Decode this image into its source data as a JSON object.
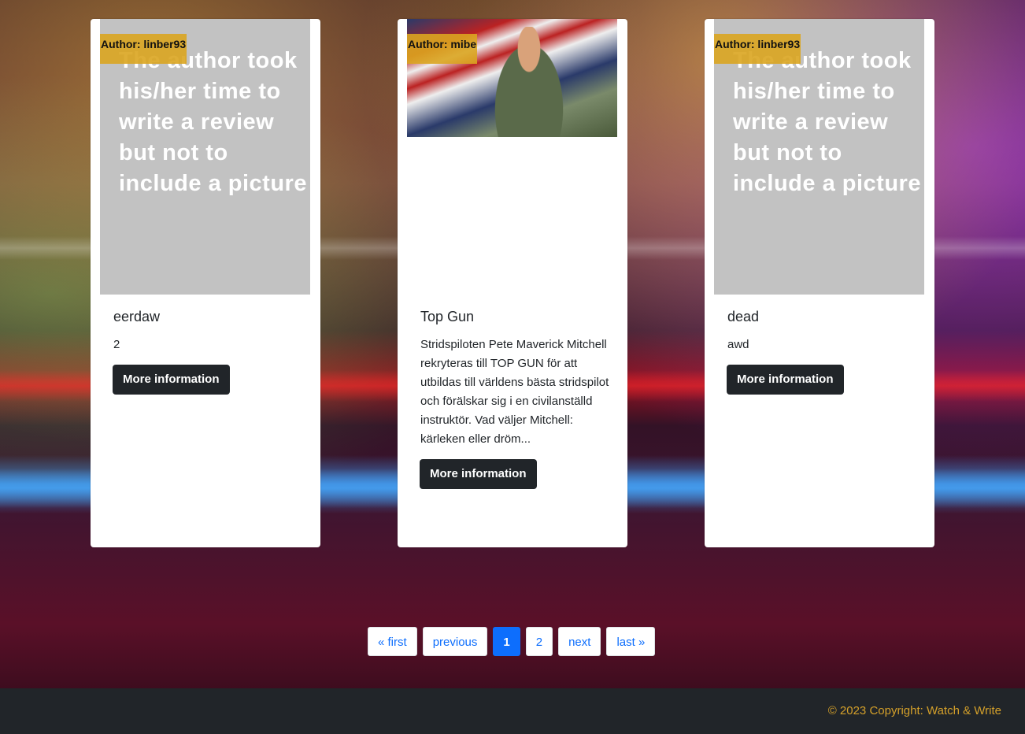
{
  "cards": [
    {
      "author": "Author: linber93",
      "placeholder": "The author took his/her time to write a review but not to include a picture",
      "title": "eerdaw",
      "text": "2",
      "button": "More information"
    },
    {
      "author": "Author: mibe",
      "title": "Top Gun",
      "text": "Stridspiloten Pete Maverick Mitchell rekryteras till TOP GUN för att utbildas till världens bästa stridspilot och förälskar sig i en civilanställd instruktör. Vad väljer Mitchell: kärleken eller dröm...",
      "button": "More information"
    },
    {
      "author": "Author: linber93",
      "placeholder": "The author took his/her time to write a review but not to include a picture",
      "title": "dead",
      "text": "awd",
      "button": "More information"
    }
  ],
  "pagination": {
    "first": "« first",
    "previous": "previous",
    "page1": "1",
    "page2": "2",
    "next": "next",
    "last": "last »"
  },
  "footer": {
    "copyright": "© 2023 Copyright: Watch & Write"
  },
  "colors": {
    "author_tag": "#daa520",
    "button": "#212529",
    "page_active": "#0d6efd",
    "footer_bg": "#212529",
    "footer_text": "#d4a02a"
  }
}
